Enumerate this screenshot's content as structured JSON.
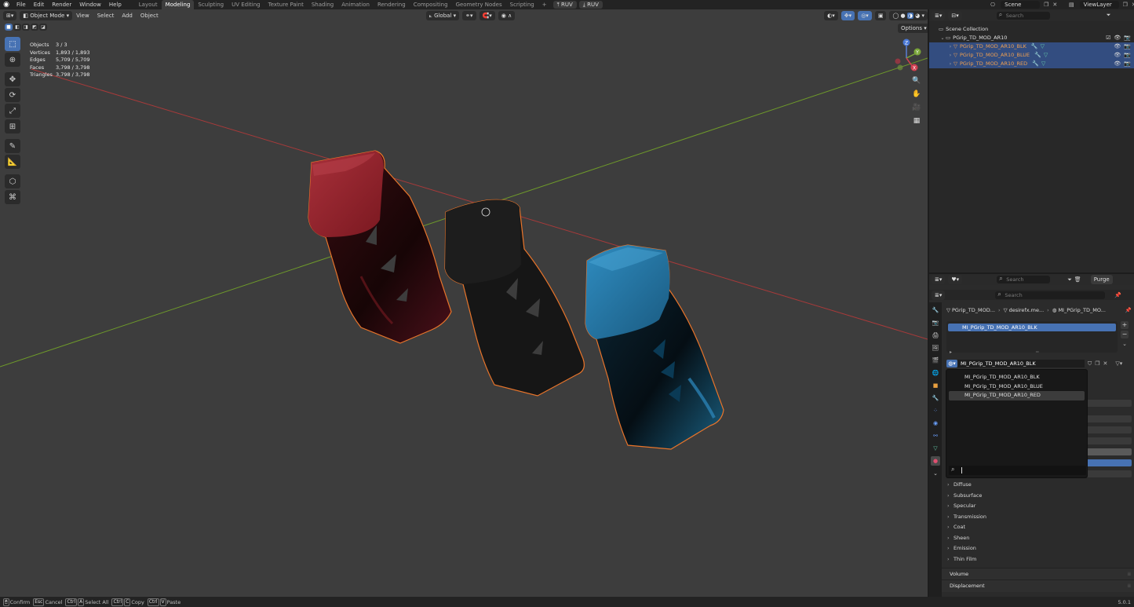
{
  "menubar": {
    "menus": [
      "File",
      "Edit",
      "Render",
      "Window",
      "Help"
    ],
    "workspaces": [
      "Layout",
      "Modeling",
      "Sculpting",
      "UV Editing",
      "Texture Paint",
      "Shading",
      "Animation",
      "Rendering",
      "Compositing",
      "Geometry Nodes",
      "Scripting"
    ],
    "active_workspace": "Modeling",
    "add_tab": "+",
    "ruv_1": "RUV",
    "ruv_2": "RUV",
    "scene_label": "Scene",
    "view_layer_label": "ViewLayer"
  },
  "viewport": {
    "mode": "Object Mode",
    "menus": [
      "View",
      "Select",
      "Add",
      "Object"
    ],
    "transform_orientation": "Global",
    "options_label": "Options",
    "stats": [
      {
        "label": "Objects",
        "value": "3 / 3"
      },
      {
        "label": "Vertices",
        "value": "1,893 / 1,893"
      },
      {
        "label": "Edges",
        "value": "5,709 / 5,709"
      },
      {
        "label": "Faces",
        "value": "3,798 / 3,798"
      },
      {
        "label": "Triangles",
        "value": "3,798 / 3,798"
      }
    ],
    "gizmo": {
      "z": "Z",
      "y": "Y",
      "x": "X"
    }
  },
  "outliner": {
    "search_placeholder": "Search",
    "scene_collection": "Scene Collection",
    "collection": "PGrip_TD_MOD_AR10",
    "objects": [
      {
        "name": "PGrip_TD_MOD_AR10_BLK"
      },
      {
        "name": "PGrip_TD_MOD_AR10_BLUE"
      },
      {
        "name": "PGrip_TD_MOD_AR10_RED"
      }
    ]
  },
  "properties": {
    "search_placeholder": "Search",
    "purge_label": "Purge",
    "search2_placeholder": "Search",
    "breadcrumb": [
      "PGrip_TD_MOD...",
      "desirefx.me...",
      "MI_PGrip_TD_MO..."
    ],
    "slot": "MI_PGrip_TD_MOD_AR10_BLK",
    "material_field": "MI_PGrip_TD_MOD_AR10_BLK",
    "dropdown_items": [
      "MI_PGrip_TD_MOD_AR10_BLK",
      "MI_PGrip_TD_MOD_AR10_BLUE",
      "MI_PGrip_TD_MOD_AR10_RED"
    ],
    "sections": [
      "Diffuse",
      "Subsurface",
      "Specular",
      "Transmission",
      "Coat",
      "Sheen",
      "Emission",
      "Thin Film"
    ],
    "panels": [
      "Volume",
      "Displacement"
    ]
  },
  "statusbar": {
    "items": [
      {
        "keys": [
          "LMB"
        ],
        "label": "Confirm"
      },
      {
        "keys": [
          "Esc"
        ],
        "label": "Cancel"
      },
      {
        "keys": [
          "Ctrl",
          "A"
        ],
        "label": "Select All"
      },
      {
        "keys": [
          "Ctrl",
          "C"
        ],
        "label": "Copy"
      },
      {
        "keys": [
          "Ctrl",
          "V"
        ],
        "label": "Paste"
      }
    ],
    "version": "5.0.1"
  },
  "colors": {
    "accent": "#4772b3",
    "selection_outline": "#e8742a",
    "red_grip": "#8e1c25",
    "blue_grip": "#1f6a93",
    "black_grip": "#161616"
  }
}
